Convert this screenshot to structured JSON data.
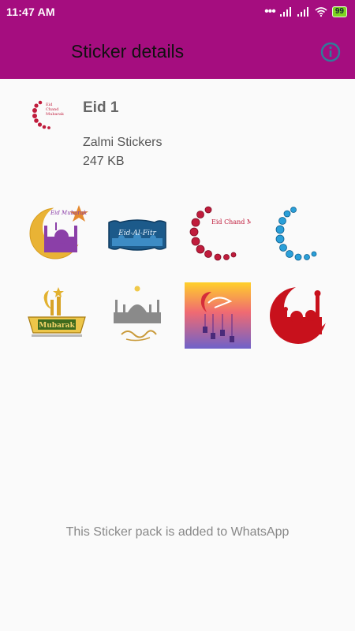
{
  "status_bar": {
    "time": "11:47 AM",
    "battery": "99"
  },
  "app_bar": {
    "title": "Sticker details"
  },
  "pack": {
    "name": "Eid 1",
    "publisher": "Zalmi Stickers",
    "size": "247 KB"
  },
  "stickers": [
    {
      "text": "Eid Mubarak"
    },
    {
      "text": "Eid-Al-Fitr"
    },
    {
      "text": "Eid Chand Mubarak"
    },
    {
      "text": ""
    },
    {
      "text": "Mubarak"
    },
    {
      "text": ""
    },
    {
      "text": ""
    },
    {
      "text": ""
    }
  ],
  "footer": {
    "message": "This Sticker pack is added to WhatsApp"
  }
}
